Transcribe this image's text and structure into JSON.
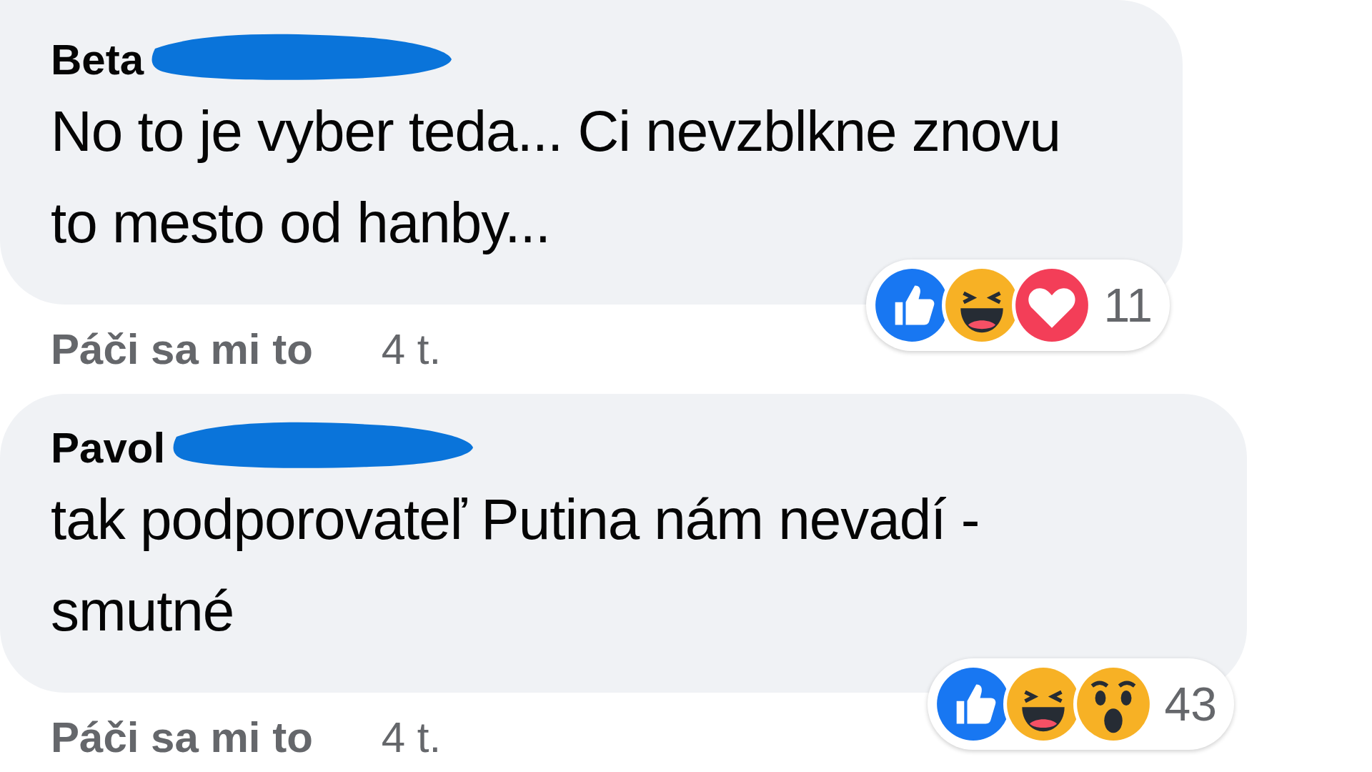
{
  "comments": [
    {
      "author": "Beta",
      "redacted": true,
      "text": "No to je vyber teda... Ci nevzblkne znovu to mesto od hanby...",
      "reactions": [
        {
          "kind": "like"
        },
        {
          "kind": "haha"
        },
        {
          "kind": "love"
        }
      ],
      "reaction_count": "11",
      "like_label": "Páči sa mi to",
      "time": "4 t."
    },
    {
      "author": "Pavol",
      "redacted": true,
      "text": "tak podporovateľ Putina nám nevadí - smutné",
      "reactions": [
        {
          "kind": "like"
        },
        {
          "kind": "haha"
        },
        {
          "kind": "wow"
        }
      ],
      "reaction_count": "43",
      "like_label": "Páči sa mi to",
      "time": "4 t."
    }
  ]
}
